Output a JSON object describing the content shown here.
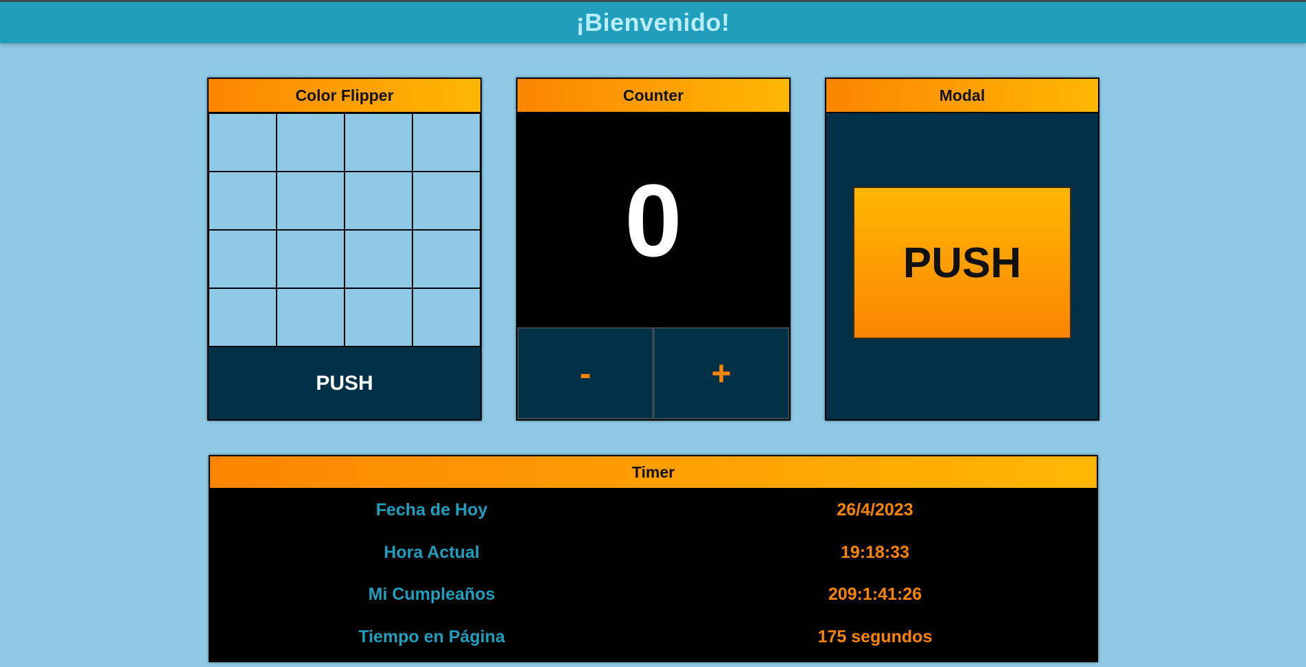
{
  "header": {
    "title": "¡Bienvenido!"
  },
  "color_flipper": {
    "title": "Color Flipper",
    "cell_color": "#8ecae6",
    "button_label": "PUSH"
  },
  "counter": {
    "title": "Counter",
    "value": "0",
    "decrement_label": "-",
    "increment_label": "+"
  },
  "modal": {
    "title": "Modal",
    "button_label": "PUSH"
  },
  "timer": {
    "title": "Timer",
    "rows": [
      {
        "label": "Fecha de Hoy",
        "value": "26/4/2023"
      },
      {
        "label": "Hora Actual",
        "value": "19:18:33"
      },
      {
        "label": "Mi Cumpleaños",
        "value": "209:1:41:26"
      },
      {
        "label": "Tiempo en Página",
        "value": "175 segundos"
      }
    ]
  },
  "colors": {
    "background": "#8ecae6",
    "header_bar": "#219ebc",
    "panel_dark": "#023047",
    "accent_orange": "#fb8500",
    "accent_yellow": "#ffb703"
  }
}
